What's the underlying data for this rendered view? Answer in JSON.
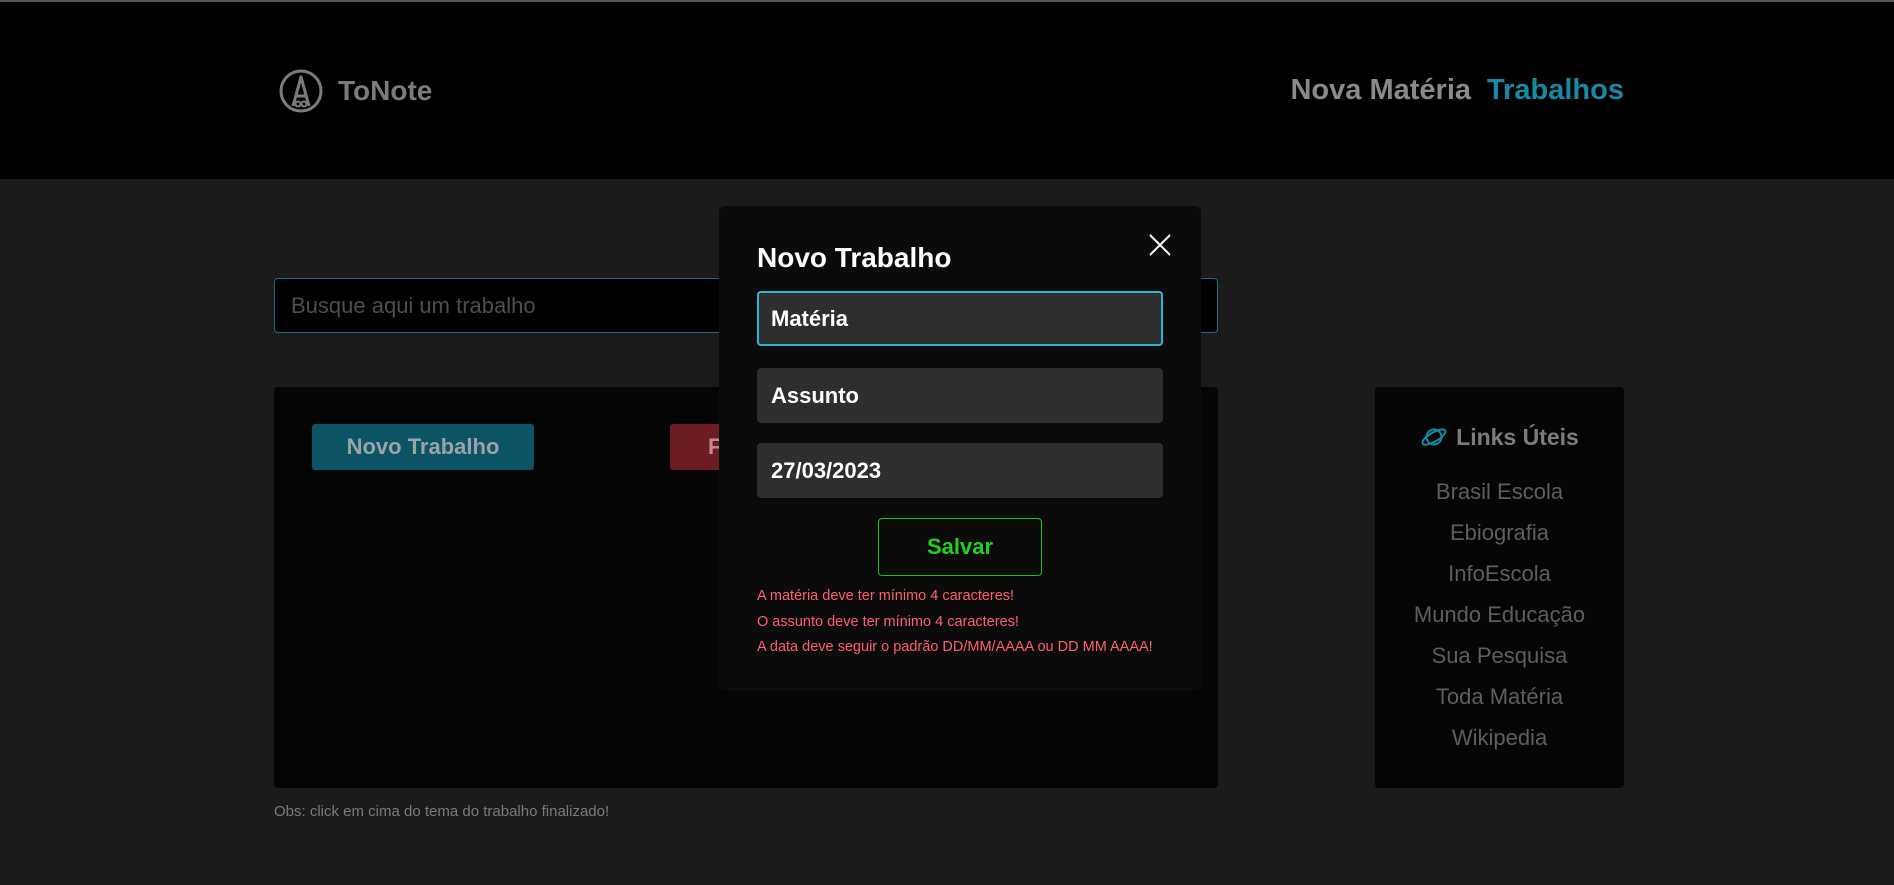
{
  "header": {
    "brand": "ToNote",
    "nav": [
      {
        "label": "Nova Matéria"
      },
      {
        "label": "Trabalhos"
      }
    ]
  },
  "search": {
    "placeholder": "Busque aqui um trabalho"
  },
  "main": {
    "new_button": "Novo Trabalho",
    "red_button_partial": "F",
    "obs": "Obs: click em cima do tema do trabalho finalizado!"
  },
  "links": {
    "title": "Links Úteis",
    "items": [
      "Brasil Escola",
      "Ebiografia",
      "InfoEscola",
      "Mundo Educação",
      "Sua Pesquisa",
      "Toda Matéria",
      "Wikipedia"
    ]
  },
  "modal": {
    "title": "Novo Trabalho",
    "fields": {
      "materia_placeholder": "Matéria",
      "assunto_placeholder": "Assunto",
      "data_value": "27/03/2023"
    },
    "save": "Salvar",
    "errors": [
      "A matéria deve ter mínimo 4 caracteres!",
      "O assunto deve ter mínimo 4 caracteres!",
      "A data deve seguir o padrão DD/MM/AAAA ou DD MM AAAA!"
    ]
  },
  "colors": {
    "accent": "#1789a3",
    "focus_border": "#2bb4d6",
    "save_green": "#22d022",
    "error_red": "#ff5f6e"
  }
}
